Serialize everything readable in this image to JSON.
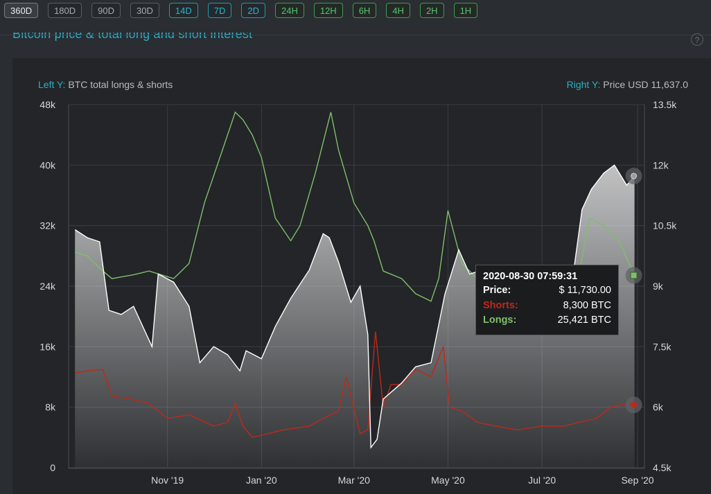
{
  "toolbar": {
    "ranges": [
      {
        "label": "360D",
        "group": "long",
        "active": true
      },
      {
        "label": "180D",
        "group": "long",
        "active": false
      },
      {
        "label": "90D",
        "group": "long",
        "active": false
      },
      {
        "label": "30D",
        "group": "long",
        "active": false
      },
      {
        "label": "14D",
        "group": "mid",
        "active": false
      },
      {
        "label": "7D",
        "group": "mid",
        "active": false
      },
      {
        "label": "2D",
        "group": "mid",
        "active": false
      },
      {
        "label": "24H",
        "group": "short",
        "active": false
      },
      {
        "label": "12H",
        "group": "short",
        "active": false
      },
      {
        "label": "6H",
        "group": "short",
        "active": false
      },
      {
        "label": "4H",
        "group": "short",
        "active": false
      },
      {
        "label": "2H",
        "group": "short",
        "active": false
      },
      {
        "label": "1H",
        "group": "short",
        "active": false
      }
    ]
  },
  "panel": {
    "title": "Bitcoin price & total long and short interest",
    "help_icon": "question-circle-icon"
  },
  "colors": {
    "price": "#ffffff",
    "longs": "#7fbf6a",
    "shorts": "#c0281a",
    "accent": "#2ab0c7"
  },
  "chart_data": {
    "type": "line",
    "left_axis": {
      "prefix": "Left Y:",
      "label": "BTC total longs & shorts",
      "ticks": [
        "0",
        "8k",
        "16k",
        "24k",
        "32k",
        "40k",
        "48k"
      ],
      "range": [
        0,
        48000
      ]
    },
    "right_axis": {
      "prefix": "Right Y:",
      "label": "Price USD 11,637.0",
      "ticks": [
        "4.5k",
        "6k",
        "7.5k",
        "9k",
        "10.5k",
        "12k",
        "13.5k"
      ],
      "range": [
        4500,
        13500
      ]
    },
    "x_ticks": [
      "Nov '19",
      "Jan '20",
      "Mar '20",
      "May '20",
      "Jul '20",
      "Sep '20"
    ],
    "x_range": [
      "2019-09-01",
      "2020-09-01"
    ],
    "grid": true,
    "series": [
      {
        "name": "Price",
        "axis": "right",
        "x": [
          "2019-09-02",
          "2019-09-10",
          "2019-09-18",
          "2019-09-24",
          "2019-10-02",
          "2019-10-10",
          "2019-10-22",
          "2019-10-26",
          "2019-11-05",
          "2019-11-15",
          "2019-11-22",
          "2019-12-01",
          "2019-12-10",
          "2019-12-18",
          "2019-12-22",
          "2020-01-01",
          "2020-01-10",
          "2020-01-20",
          "2020-02-01",
          "2020-02-10",
          "2020-02-14",
          "2020-02-20",
          "2020-02-28",
          "2020-03-05",
          "2020-03-10",
          "2020-03-12",
          "2020-03-16",
          "2020-03-20",
          "2020-04-01",
          "2020-04-10",
          "2020-04-20",
          "2020-04-29",
          "2020-05-08",
          "2020-05-15",
          "2020-06-01",
          "2020-06-15",
          "2020-07-01",
          "2020-07-15",
          "2020-07-22",
          "2020-07-27",
          "2020-08-02",
          "2020-08-10",
          "2020-08-17",
          "2020-08-25",
          "2020-08-30"
        ],
        "values": [
          10400,
          10200,
          10100,
          8400,
          8300,
          8500,
          7500,
          9300,
          9100,
          8500,
          7100,
          7500,
          7300,
          6900,
          7400,
          7200,
          8000,
          8700,
          9400,
          10300,
          10200,
          9600,
          8600,
          9000,
          7800,
          5000,
          5200,
          6200,
          6600,
          7000,
          7100,
          8800,
          9900,
          9300,
          9500,
          9400,
          9100,
          9200,
          9500,
          10900,
          11400,
          11800,
          12000,
          11500,
          11730
        ]
      },
      {
        "name": "Longs",
        "axis": "left",
        "x": [
          "2019-09-02",
          "2019-09-10",
          "2019-09-20",
          "2019-09-26",
          "2019-10-10",
          "2019-10-20",
          "2019-11-05",
          "2019-11-15",
          "2019-11-25",
          "2019-12-05",
          "2019-12-15",
          "2019-12-20",
          "2019-12-26",
          "2020-01-01",
          "2020-01-10",
          "2020-01-20",
          "2020-01-26",
          "2020-02-05",
          "2020-02-15",
          "2020-02-20",
          "2020-03-01",
          "2020-03-10",
          "2020-03-14",
          "2020-03-20",
          "2020-04-01",
          "2020-04-10",
          "2020-04-20",
          "2020-04-25",
          "2020-05-01",
          "2020-05-10",
          "2020-05-20",
          "2020-06-01",
          "2020-06-15",
          "2020-07-01",
          "2020-07-15",
          "2020-07-25",
          "2020-08-01",
          "2020-08-10",
          "2020-08-20",
          "2020-08-30"
        ],
        "values": [
          28500,
          28000,
          26000,
          25000,
          25500,
          26000,
          25000,
          27000,
          35000,
          41000,
          47000,
          46000,
          44000,
          41000,
          33000,
          30000,
          32000,
          39000,
          47000,
          42000,
          35000,
          32000,
          30000,
          26000,
          25000,
          23000,
          22000,
          25000,
          34000,
          27000,
          25000,
          24000,
          23000,
          22500,
          23500,
          25500,
          33000,
          32000,
          30000,
          25421
        ]
      },
      {
        "name": "Shorts",
        "axis": "left",
        "x": [
          "2019-09-02",
          "2019-09-10",
          "2019-09-20",
          "2019-09-26",
          "2019-10-10",
          "2019-10-20",
          "2019-11-01",
          "2019-11-15",
          "2019-12-01",
          "2019-12-10",
          "2019-12-15",
          "2019-12-20",
          "2019-12-26",
          "2020-01-05",
          "2020-01-15",
          "2020-02-01",
          "2020-02-10",
          "2020-02-20",
          "2020-02-25",
          "2020-03-05",
          "2020-03-10",
          "2020-03-13",
          "2020-03-15",
          "2020-03-20",
          "2020-03-25",
          "2020-04-01",
          "2020-04-10",
          "2020-04-20",
          "2020-04-28",
          "2020-05-02",
          "2020-05-10",
          "2020-05-20",
          "2020-06-01",
          "2020-06-15",
          "2020-07-01",
          "2020-07-15",
          "2020-07-25",
          "2020-08-05",
          "2020-08-15",
          "2020-08-25",
          "2020-08-30"
        ],
        "values": [
          12500,
          12800,
          13000,
          9500,
          9000,
          8500,
          6500,
          7000,
          5500,
          6000,
          8500,
          5500,
          4000,
          4500,
          5000,
          5500,
          6500,
          7500,
          12000,
          4500,
          5000,
          13000,
          18000,
          8000,
          11000,
          11000,
          13000,
          12000,
          16000,
          8000,
          7500,
          6000,
          5500,
          5000,
          5500,
          5500,
          6000,
          6500,
          8000,
          8500,
          8300
        ]
      }
    ],
    "tooltip": {
      "date": "2020-08-30 07:59:31",
      "price_label": "Price:",
      "price_value": "$ 11,730.00",
      "shorts_label": "Shorts:",
      "shorts_value": "8,300 BTC",
      "longs_label": "Longs:",
      "longs_value": "25,421 BTC"
    }
  }
}
